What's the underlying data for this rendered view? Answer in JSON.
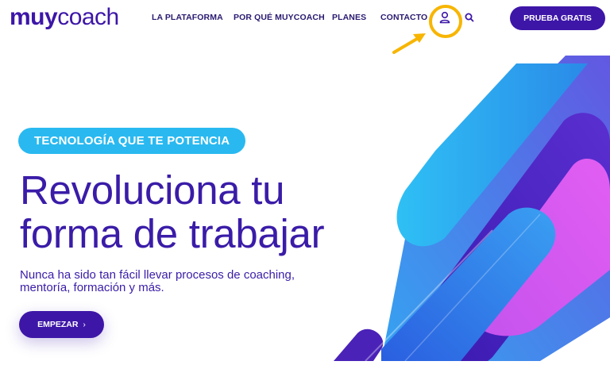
{
  "brand": {
    "logo_bold": "muy",
    "logo_light": "coach"
  },
  "nav": {
    "items": [
      {
        "label": "LA PLATAFORMA"
      },
      {
        "label": "POR QUÉ MUYCOACH"
      },
      {
        "label": "PLANES"
      },
      {
        "label": "CONTACTO"
      }
    ],
    "user_icon": "user-icon",
    "search_icon": "search-icon",
    "cta_label": "PRUEBA GRATIS"
  },
  "hero": {
    "badge": "TECNOLOGÍA QUE TE POTENCIA",
    "headline_line1": "Revoluciona tu",
    "headline_line2": "forma de trabajar",
    "subtitle_line1": "Nunca ha sido tan fácil llevar procesos de coaching,",
    "subtitle_line2": "mentoría, formación y más.",
    "button_label": "EMPEZAR",
    "button_icon": "chevron-right-icon"
  },
  "colors": {
    "brand_purple": "#3d16a8",
    "badge_blue": "#29b9f0",
    "highlight_yellow": "#f7b500"
  }
}
